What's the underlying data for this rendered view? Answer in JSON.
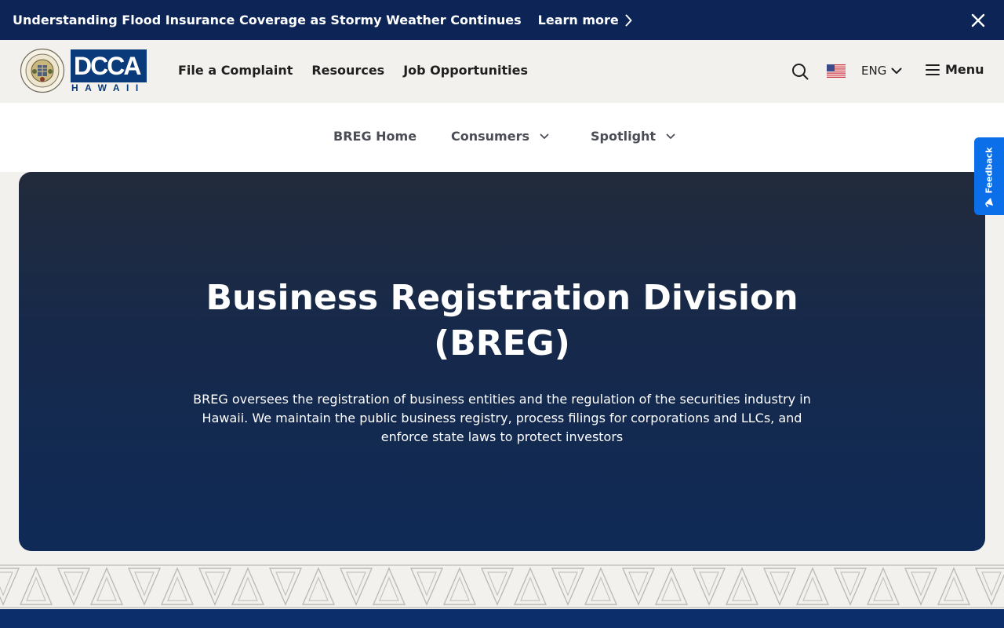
{
  "alert": {
    "text": "Understanding Flood Insurance Coverage as Stormy Weather Continues",
    "link_label": "Learn more",
    "link_icon": "chevron-right-icon",
    "close_icon": "close-icon"
  },
  "header": {
    "seal_text": "STATE OF HAWAII",
    "logo": {
      "main": "DCCA",
      "sub": "HAWAII"
    },
    "nav": [
      {
        "label": "File a Complaint"
      },
      {
        "label": "Resources"
      },
      {
        "label": "Job Opportunities"
      }
    ],
    "search_icon": "search-icon",
    "flag_icon": "us-flag-icon",
    "language": "ENG",
    "menu_label": "Menu"
  },
  "subnav": {
    "items": [
      {
        "label": "BREG Home",
        "has_dropdown": false
      },
      {
        "label": "Consumers",
        "has_dropdown": true
      },
      {
        "label": "Spotlight",
        "has_dropdown": true
      }
    ]
  },
  "feedback": {
    "label": "Feedback"
  },
  "hero": {
    "title": "Business Registration Division (BREG)",
    "description": "BREG oversees the registration of business entities and the regulation of the securities industry in Hawaii. We maintain the public business registry, process filings for corporations and LLCs, and enforce state laws to protect investors"
  },
  "colors": {
    "alert_bg": "#0c2556",
    "logo_blue": "#0b3a7a",
    "hero_top": "#222b3b",
    "hero_bottom": "#0f2a57",
    "feedback_blue": "#0a6fe8",
    "page_bg": "#f3f1ee"
  }
}
